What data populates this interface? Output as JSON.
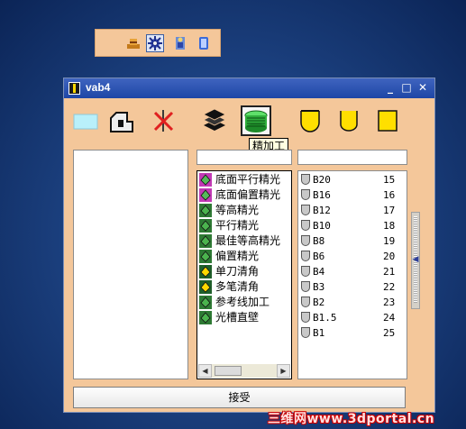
{
  "window": {
    "title": "vab4",
    "minimize_label": "_",
    "maximize_label": "□",
    "close_label": "✕"
  },
  "top_toolbar": {
    "icons": [
      "hat-icon",
      "gear-icon",
      "figure-icon",
      "cup-icon"
    ]
  },
  "tool_icons": [
    "material-icon",
    "part-icon",
    "clear-icon",
    "layers-icon",
    "finish-machining-icon",
    "ball-endmill-icon",
    "bull-endmill-icon",
    "flat-endmill-icon"
  ],
  "tooltip": "精加工",
  "strategies": [
    {
      "label": "底面平行精光",
      "icon_color": "#55b85a",
      "icon_bg": "#c23ab5"
    },
    {
      "label": "底面偏置精光",
      "icon_color": "#55b85a",
      "icon_bg": "#c23ab5"
    },
    {
      "label": "等高精光",
      "icon_color": "#4bb34e",
      "icon_bg": "#2e7a34"
    },
    {
      "label": "平行精光",
      "icon_color": "#4bb34e",
      "icon_bg": "#2e7a34"
    },
    {
      "label": "最佳等高精光",
      "icon_color": "#4bb34e",
      "icon_bg": "#2e7a34"
    },
    {
      "label": "偏置精光",
      "icon_color": "#4bb34e",
      "icon_bg": "#2e7a34"
    },
    {
      "label": "单刀清角",
      "icon_color": "#ffd800",
      "icon_bg": "#1f5f2a"
    },
    {
      "label": "多笔清角",
      "icon_color": "#ffd800",
      "icon_bg": "#1f5f2a"
    },
    {
      "label": "参考线加工",
      "icon_color": "#4bb34e",
      "icon_bg": "#2e7a34"
    },
    {
      "label": "光槽直壁",
      "icon_color": "#4bb34e",
      "icon_bg": "#2e7a34"
    }
  ],
  "tools": [
    {
      "name": "B20",
      "number": "15"
    },
    {
      "name": "B16",
      "number": "16"
    },
    {
      "name": "B12",
      "number": "17"
    },
    {
      "name": "B10",
      "number": "18"
    },
    {
      "name": "B8",
      "number": "19"
    },
    {
      "name": "B6",
      "number": "20"
    },
    {
      "name": "B4",
      "number": "21"
    },
    {
      "name": "B3",
      "number": "22"
    },
    {
      "name": "B2",
      "number": "23"
    },
    {
      "name": "B1.5",
      "number": "24"
    },
    {
      "name": "B1",
      "number": "25"
    }
  ],
  "scroll": {
    "left": "◀",
    "right": "▶",
    "vertical": "◀"
  },
  "accept_label": "接受",
  "watermark": "三维网www.3dportal.cn",
  "colors": {
    "panel": "#f4c79a",
    "titlebar": "#1e46a6",
    "desktop": "#1d4383"
  }
}
